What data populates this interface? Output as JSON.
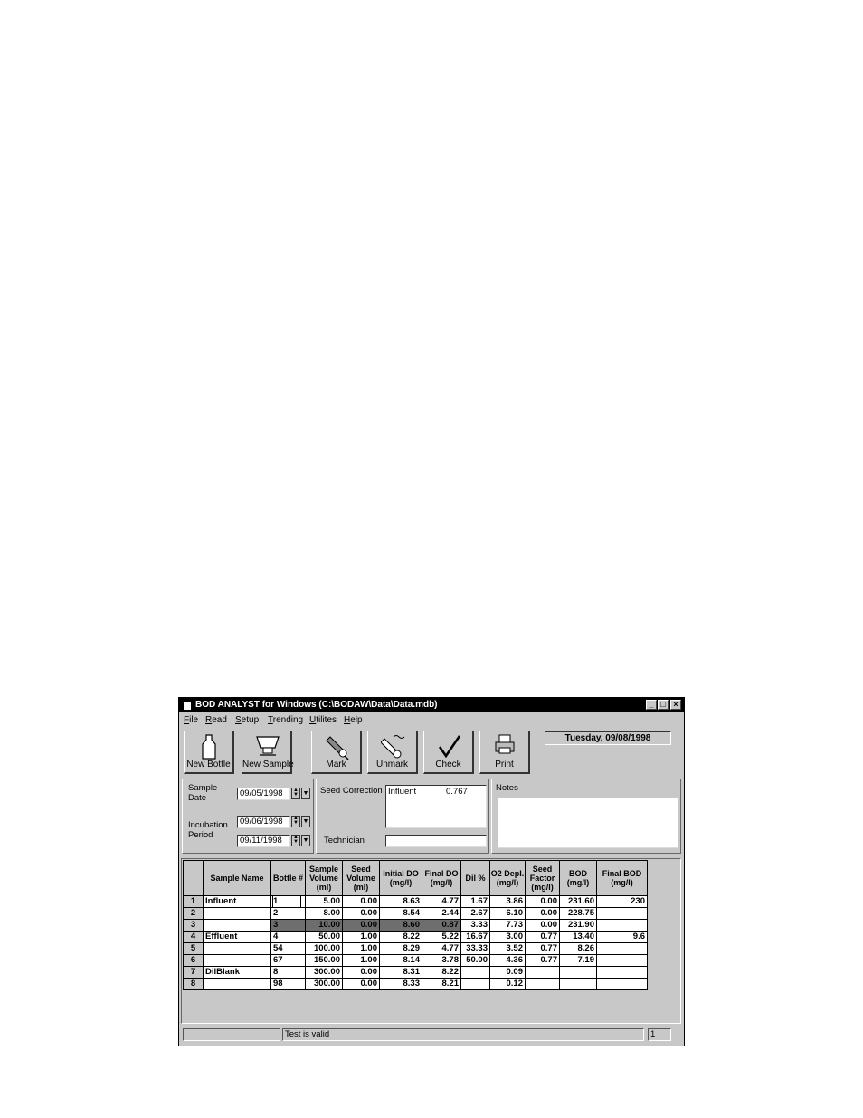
{
  "window": {
    "title": "BOD ANALYST for Windows (C:\\BODAW\\Data\\Data.mdb)",
    "min": "_",
    "max": "□",
    "close": "×"
  },
  "menu": [
    {
      "u": "F",
      "rest": "ile"
    },
    {
      "u": "R",
      "rest": "ead"
    },
    {
      "u": "S",
      "rest": "etup"
    },
    {
      "u": "T",
      "rest": "rending"
    },
    {
      "u": "U",
      "rest": "tilites"
    },
    {
      "u": "H",
      "rest": "elp"
    }
  ],
  "toolbar": {
    "new_bottle": "New Bottle",
    "new_sample": "New Sample",
    "mark": "Mark",
    "unmark": "Unmark",
    "check": "Check",
    "print": "Print"
  },
  "date_display": "Tuesday, 09/08/1998",
  "dates": {
    "sample_date_label": "Sample Date",
    "sample_date": "09/05/1998",
    "incubation_label": "Incubation Period",
    "incubation_start": "09/06/1998",
    "incubation_end": "09/11/1998"
  },
  "seed": {
    "label": "Seed Correction",
    "source": "Influent",
    "value": "0.767",
    "technician_label": "Technician",
    "technician": ""
  },
  "notes": {
    "label": "Notes",
    "text": ""
  },
  "table": {
    "columns": [
      "Sample Name",
      "Bottle #",
      "Sample Volume (ml)",
      "Seed Volume (ml)",
      "Initial DO (mg/l)",
      "Final DO (mg/l)",
      "Dil %",
      "O2 Depl. (mg/l)",
      "Seed Factor (mg/l)",
      "BOD (mg/l)",
      "Final BOD (mg/l)"
    ],
    "rows": [
      {
        "n": "1",
        "name": "Influent",
        "bottle": "1",
        "svol": "5.00",
        "seedvol": "0.00",
        "ido": "8.63",
        "fdo": "4.77",
        "dil": "1.67",
        "o2": "3.86",
        "sf": "0.00",
        "bod": "231.60",
        "fbod": "230"
      },
      {
        "n": "2",
        "name": "",
        "bottle": "2",
        "svol": "8.00",
        "seedvol": "0.00",
        "ido": "8.54",
        "fdo": "2.44",
        "dil": "2.67",
        "o2": "6.10",
        "sf": "0.00",
        "bod": "228.75",
        "fbod": ""
      },
      {
        "n": "3",
        "name": "",
        "bottle": "3",
        "svol": "10.00",
        "seedvol": "0.00",
        "ido": "8.60",
        "fdo": "0.87",
        "dil": "3.33",
        "o2": "7.73",
        "sf": "0.00",
        "bod": "231.90",
        "fbod": ""
      },
      {
        "n": "4",
        "name": "Effluent",
        "bottle": "4",
        "svol": "50.00",
        "seedvol": "1.00",
        "ido": "8.22",
        "fdo": "5.22",
        "dil": "16.67",
        "o2": "3.00",
        "sf": "0.77",
        "bod": "13.40",
        "fbod": "9.6"
      },
      {
        "n": "5",
        "name": "",
        "bottle": "54",
        "svol": "100.00",
        "seedvol": "1.00",
        "ido": "8.29",
        "fdo": "4.77",
        "dil": "33.33",
        "o2": "3.52",
        "sf": "0.77",
        "bod": "8.26",
        "fbod": ""
      },
      {
        "n": "6",
        "name": "",
        "bottle": "67",
        "svol": "150.00",
        "seedvol": "1.00",
        "ido": "8.14",
        "fdo": "3.78",
        "dil": "50.00",
        "o2": "4.36",
        "sf": "0.77",
        "bod": "7.19",
        "fbod": ""
      },
      {
        "n": "7",
        "name": "DilBlank",
        "bottle": "8",
        "svol": "300.00",
        "seedvol": "0.00",
        "ido": "8.31",
        "fdo": "8.22",
        "dil": "",
        "o2": "0.09",
        "sf": "",
        "bod": "",
        "fbod": ""
      },
      {
        "n": "8",
        "name": "",
        "bottle": "98",
        "svol": "300.00",
        "seedvol": "0.00",
        "ido": "8.33",
        "fdo": "8.21",
        "dil": "",
        "o2": "0.12",
        "sf": "",
        "bod": "",
        "fbod": ""
      }
    ]
  },
  "status": {
    "left": "",
    "message": "Test is valid",
    "right": "1"
  }
}
